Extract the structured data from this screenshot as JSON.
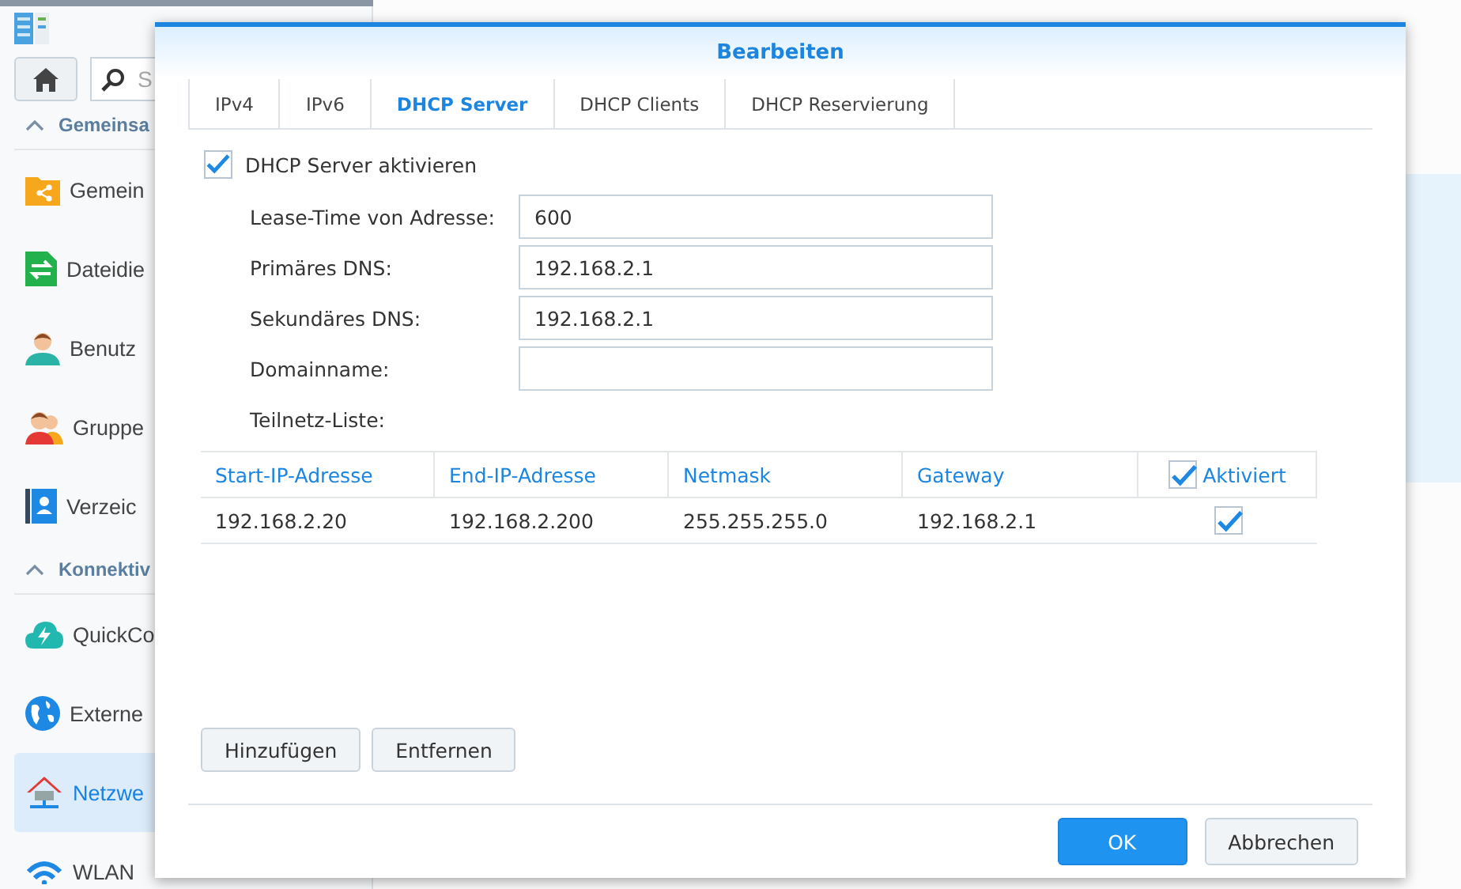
{
  "app": {
    "search": {
      "placeholder": "S"
    },
    "sidebar": {
      "sections": [
        {
          "title": "Gemeinsa",
          "expanded": true,
          "items": [
            {
              "label": "Gemein",
              "kind": "folder",
              "selected": false
            },
            {
              "label": "Dateidie",
              "kind": "transfer",
              "selected": false
            },
            {
              "label": "Benutz",
              "kind": "user",
              "selected": false
            },
            {
              "label": "Gruppe",
              "kind": "group",
              "selected": false
            },
            {
              "label": "Verzeic",
              "kind": "directory",
              "selected": false
            }
          ]
        },
        {
          "title": "Konnektiv",
          "expanded": true,
          "items": [
            {
              "label": "QuickCo",
              "kind": "cloud",
              "selected": false
            },
            {
              "label": "Externe",
              "kind": "globe",
              "selected": false
            },
            {
              "label": "Netzwe",
              "kind": "network",
              "selected": true
            },
            {
              "label": "WLAN",
              "kind": "wifi",
              "selected": false
            }
          ]
        }
      ]
    }
  },
  "dialog": {
    "title": "Bearbeiten",
    "tabs": [
      {
        "label": "IPv4",
        "selected": false
      },
      {
        "label": "IPv6",
        "selected": false
      },
      {
        "label": "DHCP Server",
        "selected": true
      },
      {
        "label": "DHCP Clients",
        "selected": false
      },
      {
        "label": "DHCP Reservierung",
        "selected": false
      }
    ],
    "enable": {
      "label": "DHCP Server aktivieren",
      "checked": true
    },
    "fields": [
      {
        "label": "Lease-Time von Adresse:",
        "value": "600"
      },
      {
        "label": "Primäres DNS:",
        "value": "192.168.2.1"
      },
      {
        "label": "Sekundäres DNS:",
        "value": "192.168.2.1"
      },
      {
        "label": "Domainname:"
      }
    ],
    "subnet_label": "Teilnetz-Liste:",
    "table": {
      "columns": [
        {
          "label": "Start-IP-Adresse"
        },
        {
          "label": "End-IP-Adresse"
        },
        {
          "label": "Netmask"
        },
        {
          "label": "Gateway"
        },
        {
          "label": "Aktiviert",
          "kind": "check",
          "checked": true
        }
      ],
      "rows": [
        {
          "cells": [
            "192.168.2.20",
            "192.168.2.200",
            "255.255.255.0",
            "192.168.2.1"
          ],
          "enabled": true
        }
      ]
    },
    "table_buttons": [
      "Hinzufügen",
      "Entfernen"
    ],
    "footer_buttons": [
      {
        "label": "OK",
        "kind": "primary"
      },
      {
        "label": "Abbrechen",
        "kind": "default"
      }
    ]
  }
}
